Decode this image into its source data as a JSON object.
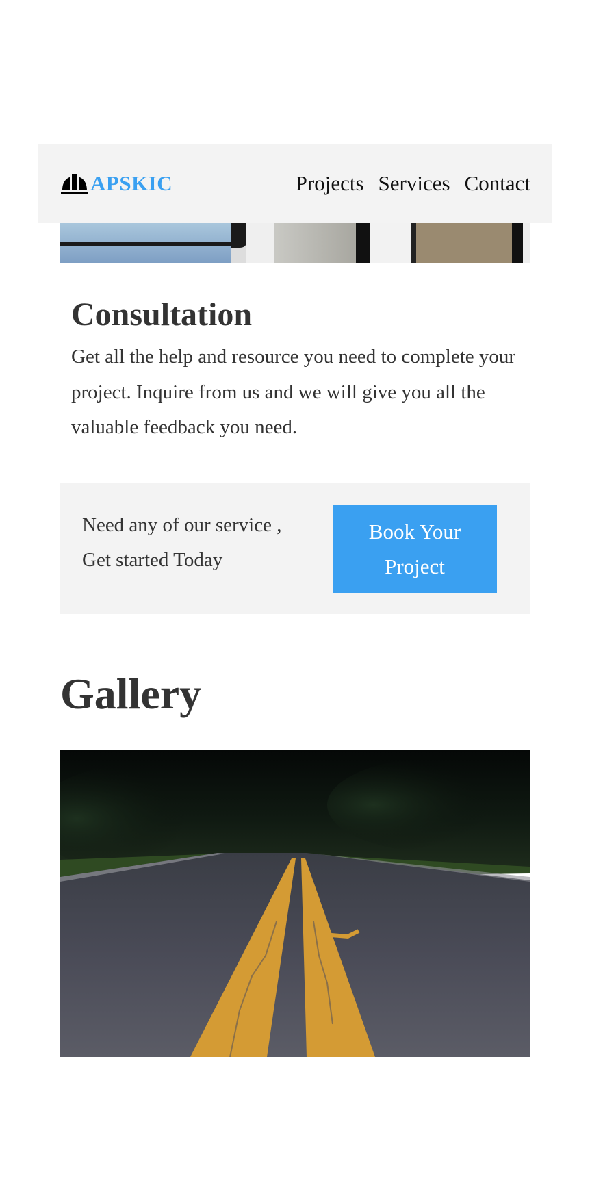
{
  "brand": {
    "name": "APSKIC",
    "icon": "hard-hat-icon",
    "color": "#3aa0f1"
  },
  "nav": {
    "items": [
      "Projects",
      "Services",
      "Contact"
    ]
  },
  "consultation": {
    "title": "Consultation",
    "body": "Get all the help and resource you need to complete your project. Inquire from us and we will give you all the valuable feedback you need."
  },
  "cta": {
    "text": "Need any of our service , Get started Today",
    "button_label": "Book Your Project",
    "button_color": "#3aa0f1"
  },
  "gallery": {
    "title": "Gallery"
  }
}
